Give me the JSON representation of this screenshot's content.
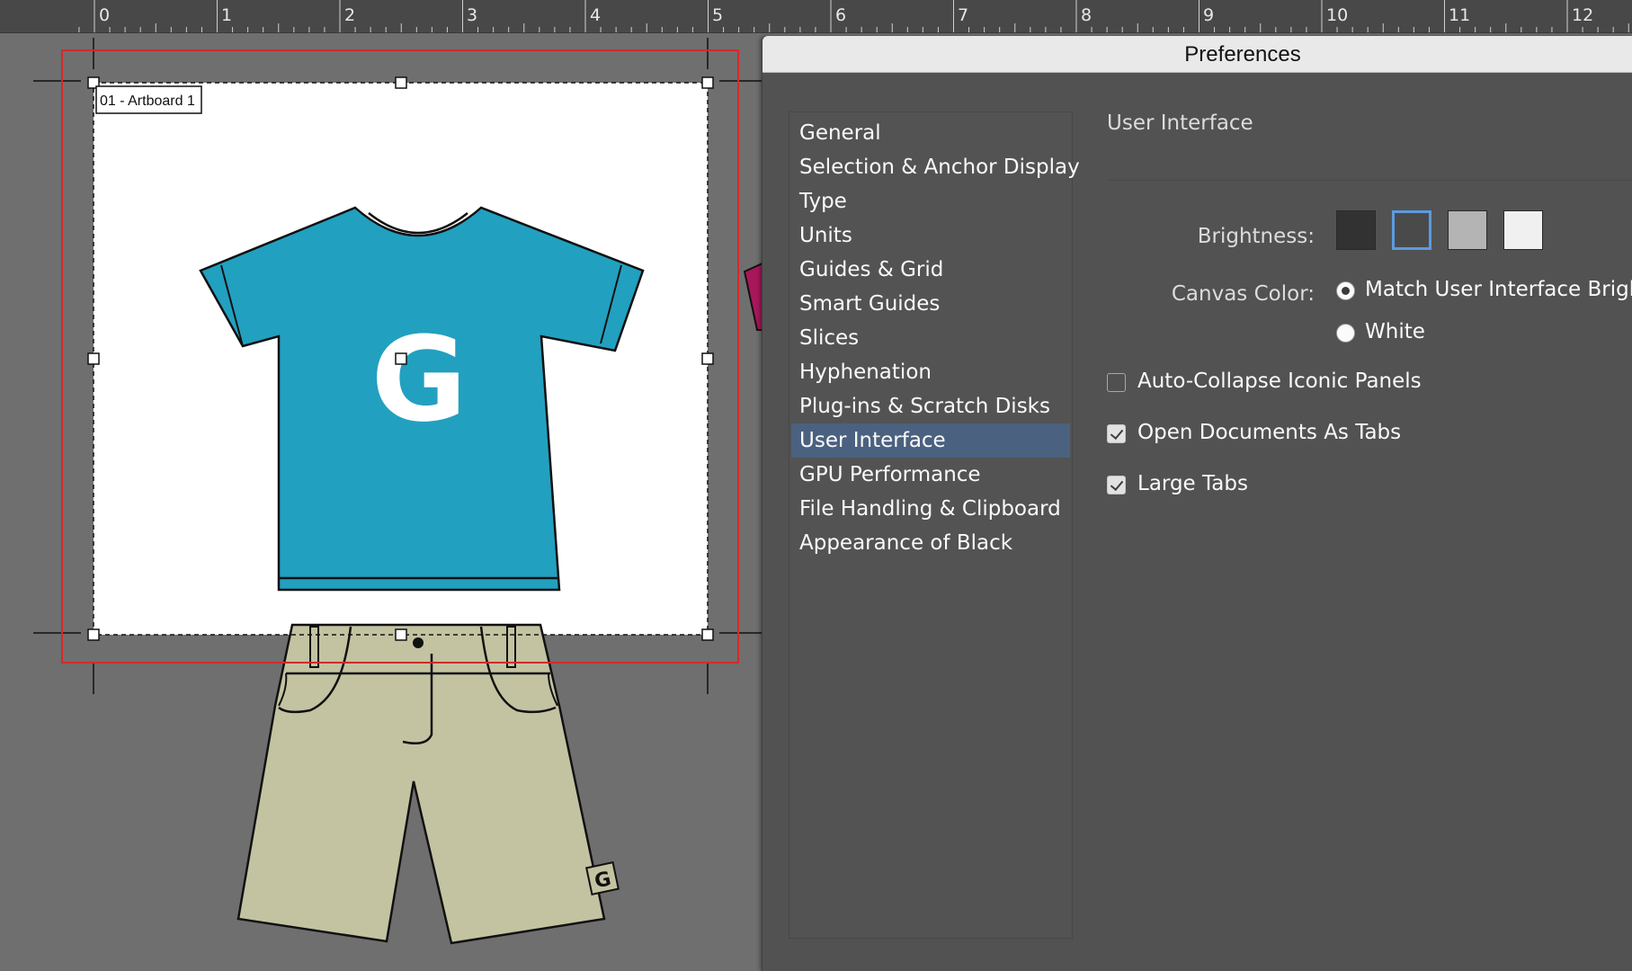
{
  "ruler": {
    "labels": [
      "0",
      "1",
      "2",
      "3",
      "4",
      "5",
      "6",
      "7",
      "8",
      "9",
      "10",
      "11",
      "12"
    ]
  },
  "artboard": {
    "label": "01 - Artboard 1"
  },
  "tshirt": {
    "letter": "G"
  },
  "shorts": {
    "tag_letter": "G"
  },
  "preferences": {
    "title": "Preferences",
    "nav": [
      {
        "label": "General"
      },
      {
        "label": "Selection & Anchor Display"
      },
      {
        "label": "Type"
      },
      {
        "label": "Units"
      },
      {
        "label": "Guides & Grid"
      },
      {
        "label": "Smart Guides"
      },
      {
        "label": "Slices"
      },
      {
        "label": "Hyphenation"
      },
      {
        "label": "Plug-ins & Scratch Disks"
      },
      {
        "label": "User Interface",
        "selected": true
      },
      {
        "label": "GPU Performance"
      },
      {
        "label": "File Handling & Clipboard"
      },
      {
        "label": "Appearance of Black"
      }
    ],
    "section_title": "User Interface",
    "brightness_label": "Brightness:",
    "brightness_swatches": [
      {
        "name": "dark",
        "color": "#323232",
        "selected": false
      },
      {
        "name": "medium-dark",
        "color": "#4a4a4a",
        "selected": true
      },
      {
        "name": "medium-light",
        "color": "#b4b4b4",
        "selected": false
      },
      {
        "name": "light",
        "color": "#f0f0f0",
        "selected": false
      }
    ],
    "canvas_color_label": "Canvas Color:",
    "canvas_options": [
      {
        "label": "Match User Interface Brightness",
        "selected": true
      },
      {
        "label": "White",
        "selected": false
      }
    ],
    "checkboxes": [
      {
        "label": "Auto-Collapse Iconic Panels",
        "checked": false
      },
      {
        "label": "Open Documents As Tabs",
        "checked": true
      },
      {
        "label": "Large Tabs",
        "checked": true
      }
    ],
    "selection_color": "#4b6180"
  }
}
